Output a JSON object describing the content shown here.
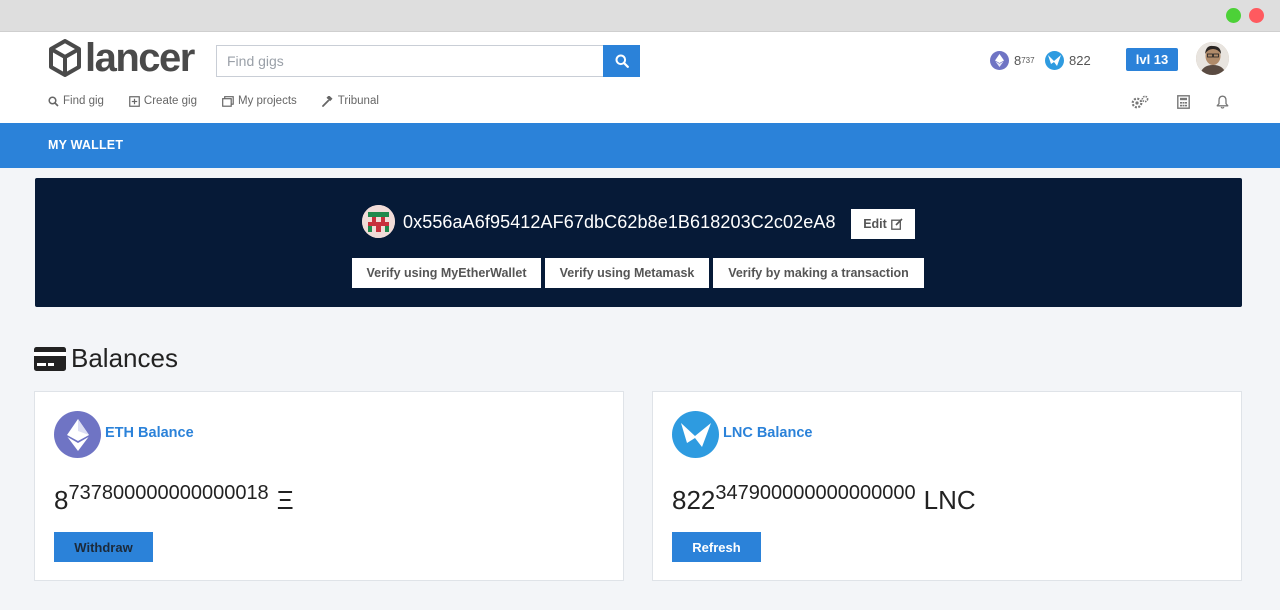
{
  "window": {
    "controls": [
      "maximize",
      "close"
    ]
  },
  "header": {
    "logo_text": "lancer",
    "search": {
      "placeholder": "Find gigs",
      "value": ""
    },
    "eth_stat": {
      "icon": "eth-icon",
      "value": "8",
      "fraction": "737"
    },
    "lnc_stat": {
      "icon": "lnc-icon",
      "value": "822"
    },
    "level_label": "lvl 13",
    "nav": [
      {
        "label": "Find gig",
        "icon": "search-icon"
      },
      {
        "label": "Create gig",
        "icon": "plus-square-icon"
      },
      {
        "label": "My projects",
        "icon": "projects-icon"
      },
      {
        "label": "Tribunal",
        "icon": "gavel-icon"
      }
    ],
    "tools": [
      "settings-icon",
      "calculator-icon",
      "bell-icon"
    ]
  },
  "wallet_bar": {
    "title": "MY WALLET"
  },
  "address_panel": {
    "address": "0x556aA6f95412AF67dbC62b8e1B618203C2c02eA8",
    "edit_label": "Edit",
    "verify_buttons": [
      "Verify using MyEtherWallet",
      "Verify using Metamask",
      "Verify by making a transaction"
    ]
  },
  "balances": {
    "heading": "Balances",
    "eth": {
      "title": "ETH Balance",
      "amount": "8",
      "fraction": "737800000000000018",
      "unit": "Ξ",
      "button": "Withdraw"
    },
    "lnc": {
      "title": "LNC Balance",
      "amount": "822",
      "fraction": "347900000000000000",
      "unit": "LNC",
      "button": "Refresh"
    }
  },
  "colors": {
    "accent": "#2b82d9",
    "panel": "#061a37",
    "eth": "#6f74c4",
    "lnc": "#2e9be0"
  }
}
